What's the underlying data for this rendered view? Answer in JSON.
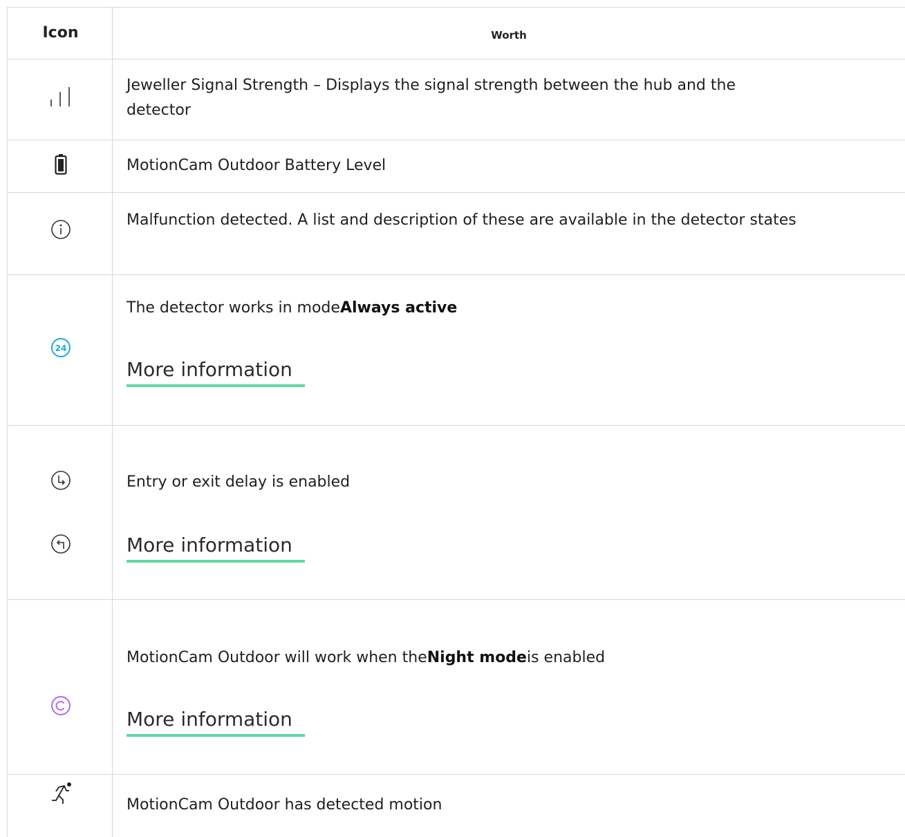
{
  "header": {
    "icon_col": "Icon",
    "value_col": "Worth"
  },
  "rows": [
    {
      "icon": "signal-strength-icon",
      "text": "Jeweller Signal Strength – Displays the signal strength between the hub and the",
      "text2": "detector"
    },
    {
      "icon": "battery-icon",
      "text": "MotionCam Outdoor Battery Level"
    },
    {
      "icon": "info-icon",
      "text": "Malfunction detected. A list and description of these are available in the detector states"
    },
    {
      "icon": "always-active-24-icon",
      "icon_label": "24",
      "text": "The detector works in mode",
      "bold": "Always active",
      "link": "More information"
    },
    {
      "icon": "entry-exit-delay-icon",
      "text": "Entry or exit delay is enabled",
      "link": "More information"
    },
    {
      "icon": "night-mode-icon",
      "text": "MotionCam Outdoor will work when the",
      "bold": "Night mode",
      "text_after": "is enabled",
      "link": "More information"
    },
    {
      "icon": "motion-detected-icon",
      "text": "MotionCam Outdoor has detected motion"
    }
  ],
  "colors": {
    "link_underline": "#5ed8a4",
    "always_active": "#1ea7e8",
    "night_mode": "#b06ef0",
    "border": "#d8d8d8"
  }
}
